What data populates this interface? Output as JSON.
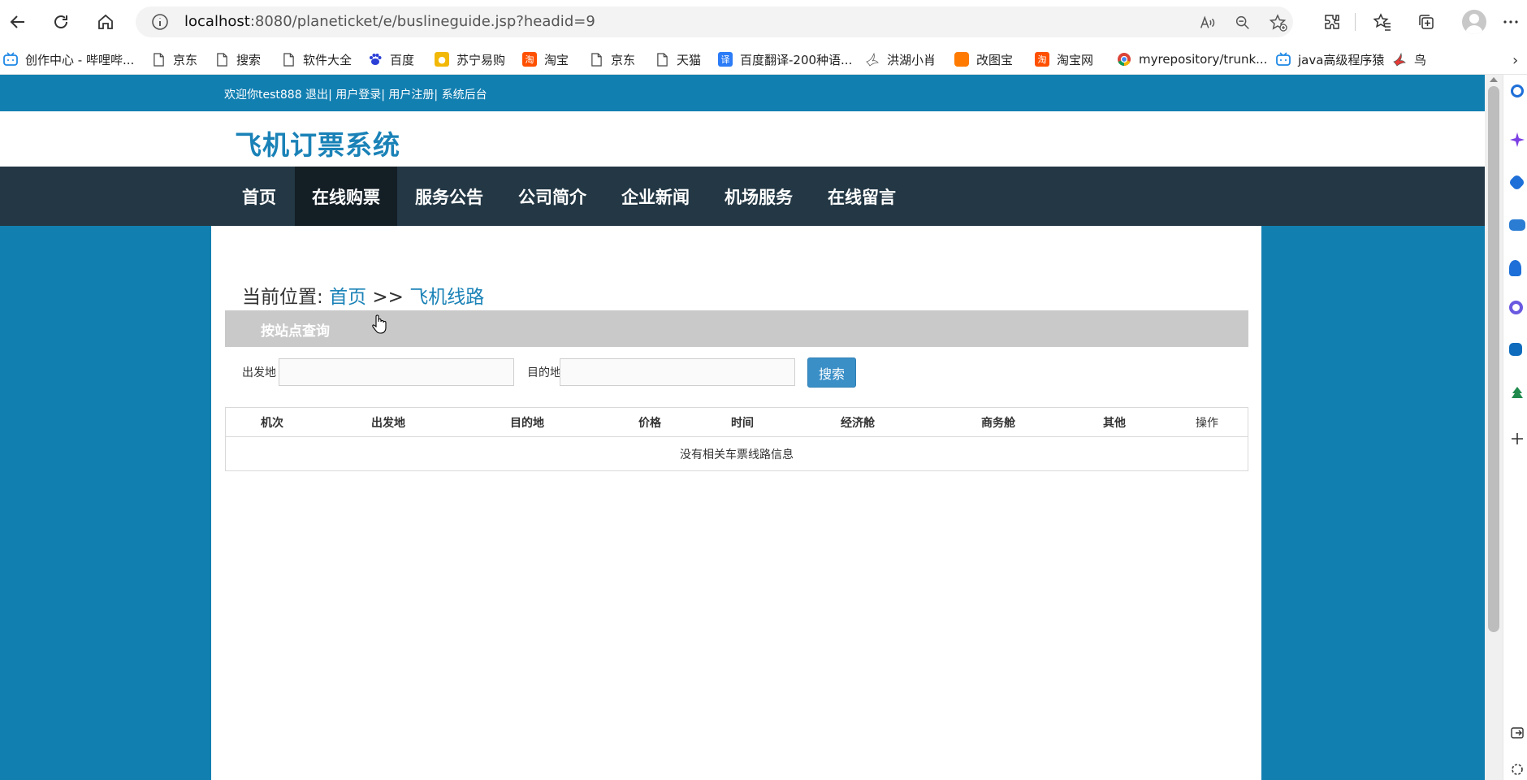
{
  "browser": {
    "url_host": "localhost",
    "url_rest": ":8080/planeticket/e/buslineguide.jsp?headid=9",
    "icons": [
      "back-icon",
      "refresh-icon",
      "home-icon",
      "info-icon",
      "read-aloud-icon",
      "zoom-icon",
      "favorite-add-icon",
      "extensions-icon",
      "favorites-icon",
      "collections-icon",
      "profile-icon",
      "more-icon"
    ]
  },
  "bookmarks": [
    {
      "label": "创作中心 - 哔哩哔...",
      "icon": "bilibili-icon",
      "color": "#1e88e5"
    },
    {
      "label": "京东",
      "icon": "page-icon",
      "color": "#ffffff"
    },
    {
      "label": "搜索",
      "icon": "page-icon",
      "color": "#ffffff"
    },
    {
      "label": "软件大全",
      "icon": "page-icon",
      "color": "#ffffff"
    },
    {
      "label": "百度",
      "icon": "baidu-icon",
      "color": "#2b3fd6"
    },
    {
      "label": "苏宁易购",
      "icon": "suning-icon",
      "color": "#f2b807"
    },
    {
      "label": "淘宝",
      "icon": "taobao-icon",
      "color": "#ff5000"
    },
    {
      "label": "京东",
      "icon": "page-icon",
      "color": "#ffffff"
    },
    {
      "label": "天猫",
      "icon": "page-icon",
      "color": "#ffffff"
    },
    {
      "label": "百度翻译-200种语...",
      "icon": "translate-icon",
      "color": "#2b7cf6"
    },
    {
      "label": "洪湖小肖",
      "icon": "bird-icon",
      "color": "#ffffff"
    },
    {
      "label": "改图宝",
      "icon": "gaitubao-icon",
      "color": "#ff7a00"
    },
    {
      "label": "淘宝网",
      "icon": "taobao-icon",
      "color": "#ff5000"
    },
    {
      "label": "myrepository/trunk...",
      "icon": "chrome-icon",
      "color": "#db4437"
    },
    {
      "label": "java高级程序猿",
      "icon": "bilibili-icon",
      "color": "#1e88e5"
    },
    {
      "label": "鸟",
      "icon": "bird-icon",
      "color": "#e53935"
    }
  ],
  "site": {
    "top_links": [
      "欢迎你test888",
      " 退出",
      "| 用户登录",
      "| 用户注册",
      "| 系统后台"
    ],
    "logo": "飞机订票系统",
    "nav": [
      "首页",
      "在线购票",
      "服务公告",
      "公司简介",
      "企业新闻",
      "机场服务",
      "在线留言"
    ],
    "nav_active": "在线购票"
  },
  "main": {
    "crumb_prefix": "当前位置: ",
    "crumb_home": "首页",
    "crumb_sep": " >> ",
    "crumb_current": "飞机线路",
    "section_title": "按站点查询",
    "from_label": "出发地",
    "from_value": "",
    "to_label": "目的地",
    "to_value": "",
    "search_label": "搜索",
    "table_headers": [
      "机次",
      "出发地",
      "目的地",
      "价格",
      "时间",
      "经济舱",
      "商务舱",
      "其他",
      "操作"
    ],
    "empty_message": "没有相关车票线路信息"
  },
  "colors": {
    "site_blue": "#127fb1",
    "nav_dark": "#233744",
    "nav_active": "#141e25",
    "link_blue": "#1a82b7",
    "button_blue": "#3a8fc7"
  }
}
